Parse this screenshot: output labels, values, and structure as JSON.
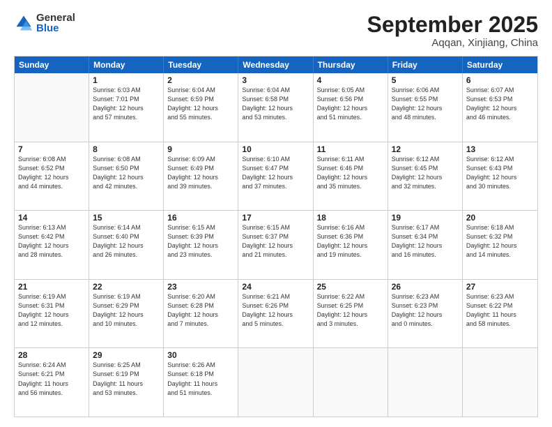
{
  "header": {
    "logo_general": "General",
    "logo_blue": "Blue",
    "month_title": "September 2025",
    "subtitle": "Aqqan, Xinjiang, China"
  },
  "weekdays": [
    "Sunday",
    "Monday",
    "Tuesday",
    "Wednesday",
    "Thursday",
    "Friday",
    "Saturday"
  ],
  "rows": [
    [
      {
        "day": "",
        "info": ""
      },
      {
        "day": "1",
        "info": "Sunrise: 6:03 AM\nSunset: 7:01 PM\nDaylight: 12 hours\nand 57 minutes."
      },
      {
        "day": "2",
        "info": "Sunrise: 6:04 AM\nSunset: 6:59 PM\nDaylight: 12 hours\nand 55 minutes."
      },
      {
        "day": "3",
        "info": "Sunrise: 6:04 AM\nSunset: 6:58 PM\nDaylight: 12 hours\nand 53 minutes."
      },
      {
        "day": "4",
        "info": "Sunrise: 6:05 AM\nSunset: 6:56 PM\nDaylight: 12 hours\nand 51 minutes."
      },
      {
        "day": "5",
        "info": "Sunrise: 6:06 AM\nSunset: 6:55 PM\nDaylight: 12 hours\nand 48 minutes."
      },
      {
        "day": "6",
        "info": "Sunrise: 6:07 AM\nSunset: 6:53 PM\nDaylight: 12 hours\nand 46 minutes."
      }
    ],
    [
      {
        "day": "7",
        "info": "Sunrise: 6:08 AM\nSunset: 6:52 PM\nDaylight: 12 hours\nand 44 minutes."
      },
      {
        "day": "8",
        "info": "Sunrise: 6:08 AM\nSunset: 6:50 PM\nDaylight: 12 hours\nand 42 minutes."
      },
      {
        "day": "9",
        "info": "Sunrise: 6:09 AM\nSunset: 6:49 PM\nDaylight: 12 hours\nand 39 minutes."
      },
      {
        "day": "10",
        "info": "Sunrise: 6:10 AM\nSunset: 6:47 PM\nDaylight: 12 hours\nand 37 minutes."
      },
      {
        "day": "11",
        "info": "Sunrise: 6:11 AM\nSunset: 6:46 PM\nDaylight: 12 hours\nand 35 minutes."
      },
      {
        "day": "12",
        "info": "Sunrise: 6:12 AM\nSunset: 6:45 PM\nDaylight: 12 hours\nand 32 minutes."
      },
      {
        "day": "13",
        "info": "Sunrise: 6:12 AM\nSunset: 6:43 PM\nDaylight: 12 hours\nand 30 minutes."
      }
    ],
    [
      {
        "day": "14",
        "info": "Sunrise: 6:13 AM\nSunset: 6:42 PM\nDaylight: 12 hours\nand 28 minutes."
      },
      {
        "day": "15",
        "info": "Sunrise: 6:14 AM\nSunset: 6:40 PM\nDaylight: 12 hours\nand 26 minutes."
      },
      {
        "day": "16",
        "info": "Sunrise: 6:15 AM\nSunset: 6:39 PM\nDaylight: 12 hours\nand 23 minutes."
      },
      {
        "day": "17",
        "info": "Sunrise: 6:15 AM\nSunset: 6:37 PM\nDaylight: 12 hours\nand 21 minutes."
      },
      {
        "day": "18",
        "info": "Sunrise: 6:16 AM\nSunset: 6:36 PM\nDaylight: 12 hours\nand 19 minutes."
      },
      {
        "day": "19",
        "info": "Sunrise: 6:17 AM\nSunset: 6:34 PM\nDaylight: 12 hours\nand 16 minutes."
      },
      {
        "day": "20",
        "info": "Sunrise: 6:18 AM\nSunset: 6:32 PM\nDaylight: 12 hours\nand 14 minutes."
      }
    ],
    [
      {
        "day": "21",
        "info": "Sunrise: 6:19 AM\nSunset: 6:31 PM\nDaylight: 12 hours\nand 12 minutes."
      },
      {
        "day": "22",
        "info": "Sunrise: 6:19 AM\nSunset: 6:29 PM\nDaylight: 12 hours\nand 10 minutes."
      },
      {
        "day": "23",
        "info": "Sunrise: 6:20 AM\nSunset: 6:28 PM\nDaylight: 12 hours\nand 7 minutes."
      },
      {
        "day": "24",
        "info": "Sunrise: 6:21 AM\nSunset: 6:26 PM\nDaylight: 12 hours\nand 5 minutes."
      },
      {
        "day": "25",
        "info": "Sunrise: 6:22 AM\nSunset: 6:25 PM\nDaylight: 12 hours\nand 3 minutes."
      },
      {
        "day": "26",
        "info": "Sunrise: 6:23 AM\nSunset: 6:23 PM\nDaylight: 12 hours\nand 0 minutes."
      },
      {
        "day": "27",
        "info": "Sunrise: 6:23 AM\nSunset: 6:22 PM\nDaylight: 11 hours\nand 58 minutes."
      }
    ],
    [
      {
        "day": "28",
        "info": "Sunrise: 6:24 AM\nSunset: 6:21 PM\nDaylight: 11 hours\nand 56 minutes."
      },
      {
        "day": "29",
        "info": "Sunrise: 6:25 AM\nSunset: 6:19 PM\nDaylight: 11 hours\nand 53 minutes."
      },
      {
        "day": "30",
        "info": "Sunrise: 6:26 AM\nSunset: 6:18 PM\nDaylight: 11 hours\nand 51 minutes."
      },
      {
        "day": "",
        "info": ""
      },
      {
        "day": "",
        "info": ""
      },
      {
        "day": "",
        "info": ""
      },
      {
        "day": "",
        "info": ""
      }
    ]
  ]
}
